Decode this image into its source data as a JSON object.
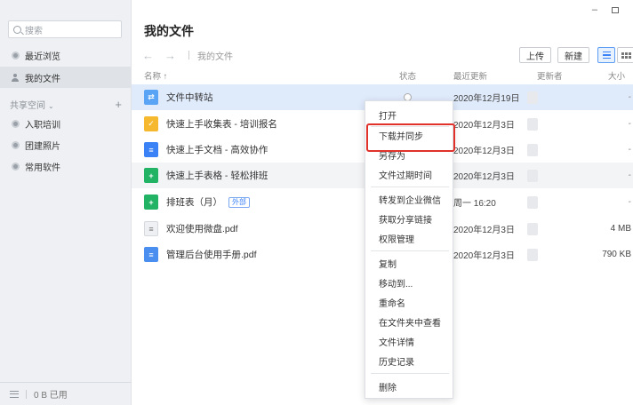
{
  "sidebar": {
    "search_placeholder": "搜索",
    "nav": [
      {
        "label": "最近浏览"
      },
      {
        "label": "我的文件"
      }
    ],
    "section_title": "共享空间",
    "section_chevron": "⌄",
    "section_add": "+",
    "spaces": [
      {
        "label": "入职培训"
      },
      {
        "label": "团建照片"
      },
      {
        "label": "常用软件"
      }
    ],
    "storage": "0 B 已用"
  },
  "window": {
    "minimize": "–"
  },
  "main": {
    "title": "我的文件",
    "back": "←",
    "forward": "→",
    "breadcrumb": "我的文件",
    "upload_label": "上传",
    "new_label": "新建"
  },
  "table": {
    "columns": {
      "name": "名称 ↑",
      "status": "状态",
      "updated": "最近更新",
      "updater": "更新者",
      "size": "大小"
    },
    "rows": [
      {
        "name": "文件中转站",
        "date": "2020年12月19日",
        "size": "-",
        "icon": "folder-icon",
        "color": "#5aa4f5"
      },
      {
        "name": "快速上手收集表 - 培训报名",
        "date": "2020年12月3日",
        "size": "-",
        "icon": "form-icon",
        "color": "#f5b82e"
      },
      {
        "name": "快速上手文档 - 高效协作",
        "date": "2020年12月3日",
        "size": "-",
        "icon": "doc-icon",
        "color": "#3b82f6"
      },
      {
        "name": "快速上手表格 - 轻松排班",
        "date": "2020年12月3日",
        "size": "-",
        "icon": "sheet-icon",
        "color": "#22b365"
      },
      {
        "name": "排班表（月）",
        "tag": "外部",
        "date": "周一 16:20",
        "size": "-",
        "icon": "sheet-icon",
        "color": "#22b365"
      },
      {
        "name": "欢迎使用微盘.pdf",
        "date": "2020年12月3日",
        "size": "4 MB",
        "icon": "pdf-icon",
        "color": "#e8eaee"
      },
      {
        "name": "管理后台使用手册.pdf",
        "date": "2020年12月3日",
        "size": "790 KB",
        "icon": "pdf-icon",
        "color": "#4a8ff0"
      }
    ]
  },
  "context_menu": {
    "items": [
      "打开",
      "下载并同步",
      "另存为",
      "文件过期时间",
      "转发到企业微信",
      "获取分享链接",
      "权限管理",
      "复制",
      "移动到...",
      "重命名",
      "在文件夹中查看",
      "文件详情",
      "历史记录",
      "删除"
    ]
  }
}
